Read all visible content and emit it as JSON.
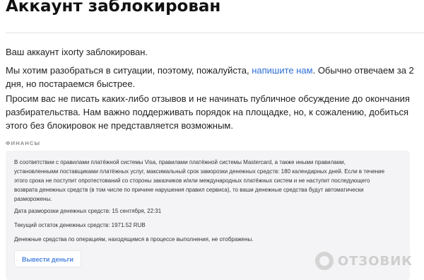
{
  "header": {
    "title": "Аккаунт заблокирован"
  },
  "main": {
    "p1": "Ваш аккаунт ixorty заблокирован.",
    "p2_before": "Мы хотим разобраться в ситуации, поэтому, пожалуйста, ",
    "p2_link": "напишите нам",
    "p2_after": ". Обычно отвечаем за 2 дня, но постараемся быстрее.",
    "p3": "Просим вас не писать каких-либо отзывов и не начинать публичное обсуждение до окончания разбирательства. Нам важно поддерживать порядок на площадке, но, к сожалению, добиться этого без блокировок не представляется возможным."
  },
  "finance": {
    "section_label": "ФИНАНСЫ",
    "body": "В соответствии с правилами платёжной системы Visa, правилами платёжной системы Mastercard, а также иными правилами, установленными поставщиками платёжных услуг, максимальный срок заморозки денежных средств: 180 календарных дней. Если в течение этого срока не поступит опротестований со стороны заказчиков и/или международных платёжных систем и не наступит последующего возврата денежных средств (в том числе по причине нарушения правил сервиса), то ваши денежные средства будут автоматически разморожены.",
    "unfreeze_date": "Дата разморозки денежных средств: 15 сентября, 22:31",
    "balance": "Текущий остаток денежных средств: 1971.52 RUB",
    "pending_note": "Денежные средства по операциям, находящимся в процессе выполнения, не отображены.",
    "withdraw_label": "Вывести деньги"
  },
  "watermark": {
    "text": "ОТЗОВИК",
    "icon": "otzovik-logo-icon"
  }
}
